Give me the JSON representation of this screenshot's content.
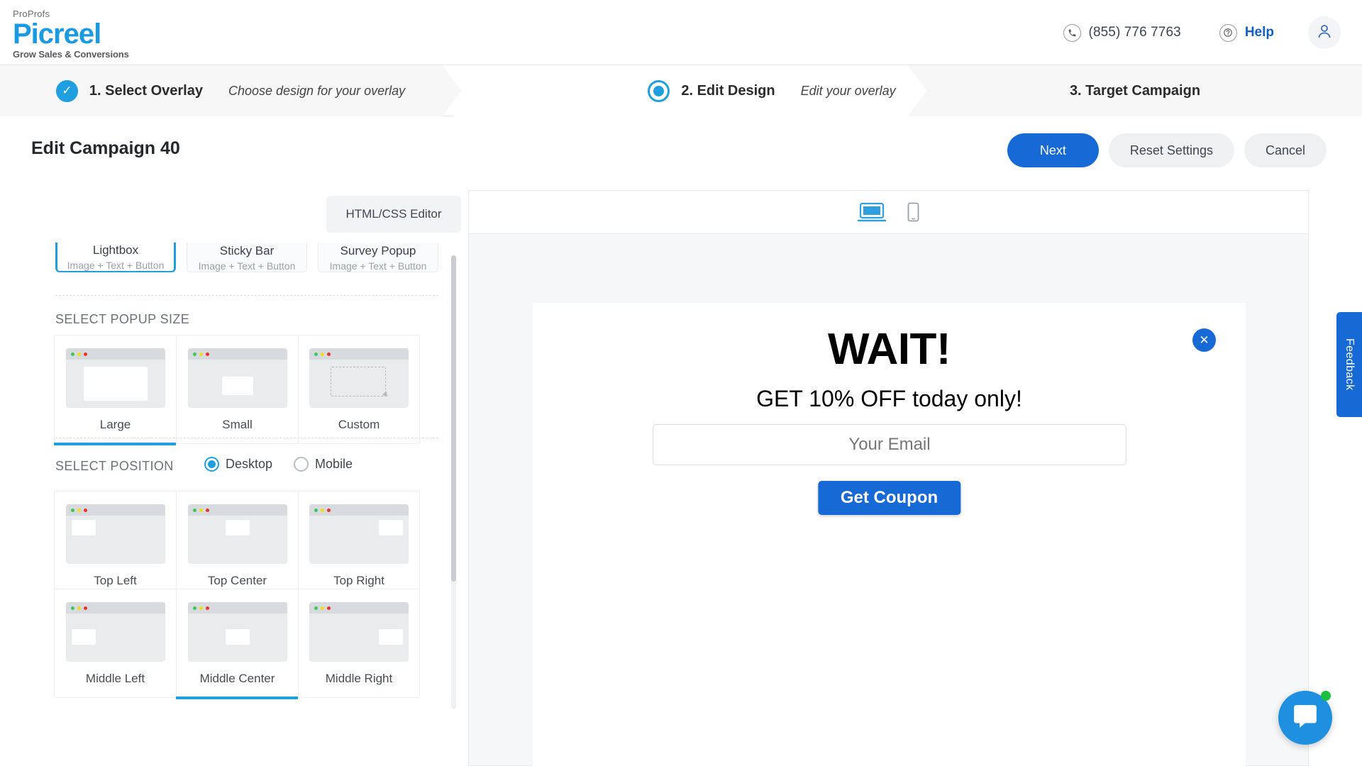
{
  "header": {
    "logo": {
      "pro": "ProProfs",
      "name": "Picreel",
      "tagline": "Grow Sales & Conversions"
    },
    "phone": "(855) 776 7763",
    "help": "Help",
    "phone_icon": "phone-icon",
    "help_icon": "question-mark-icon",
    "avatar_icon": "user-avatar-icon"
  },
  "stepper": {
    "steps": [
      {
        "label": "1. Select Overlay",
        "desc": "Choose design for your overlay",
        "state": "completed"
      },
      {
        "label": "2. Edit Design",
        "desc": "Edit your overlay",
        "state": "current"
      },
      {
        "label": "3. Target Campaign",
        "desc": "",
        "state": "upcoming"
      }
    ]
  },
  "titlebar": {
    "title": "Edit Campaign 40",
    "buttons": [
      {
        "label": "Next",
        "style": "primary"
      },
      {
        "label": "Reset Settings",
        "style": "secondary"
      },
      {
        "label": "Cancel",
        "style": "secondary"
      }
    ]
  },
  "left_panel": {
    "editor_tab": "HTML/CSS Editor",
    "type_cards": [
      {
        "title": "Lightbox",
        "subtitle": "Image + Text + Button",
        "selected": true
      },
      {
        "title": "Sticky Bar",
        "subtitle": "Image + Text + Button",
        "selected": false
      },
      {
        "title": "Survey Popup",
        "subtitle": "Image + Text + Button",
        "selected": false
      }
    ],
    "size_section": {
      "heading": "SELECT POPUP SIZE",
      "options": [
        {
          "label": "Large",
          "selected": true
        },
        {
          "label": "Small",
          "selected": false
        },
        {
          "label": "Custom",
          "selected": false
        }
      ]
    },
    "position_section": {
      "heading": "SELECT POSITION",
      "device_options": [
        {
          "label": "Desktop",
          "selected": true
        },
        {
          "label": "Mobile",
          "selected": false
        }
      ],
      "positions": [
        {
          "label": "Top Left",
          "selected": false
        },
        {
          "label": "Top Center",
          "selected": false
        },
        {
          "label": "Top Right",
          "selected": false
        },
        {
          "label": "Middle Left",
          "selected": false
        },
        {
          "label": "Middle Center",
          "selected": true
        },
        {
          "label": "Middle Right",
          "selected": false
        }
      ]
    }
  },
  "preview": {
    "device_tabs": [
      {
        "name": "desktop-view",
        "selected": true
      },
      {
        "name": "mobile-view",
        "selected": false
      }
    ],
    "popup": {
      "title": "WAIT!",
      "subtitle": "GET 10% OFF today only!",
      "email_placeholder": "Your Email",
      "button_label": "Get Coupon",
      "close_icon": "close-x-icon"
    }
  },
  "feedback_tab": {
    "label": "Feedback"
  },
  "chat": {
    "icon": "chat-bubble-icon"
  },
  "colors": {
    "brand_blue": "#1f9fe0",
    "action_blue": "#1769d6",
    "help_blue": "#1160c4",
    "panel_grey": "#f7f7f7"
  }
}
